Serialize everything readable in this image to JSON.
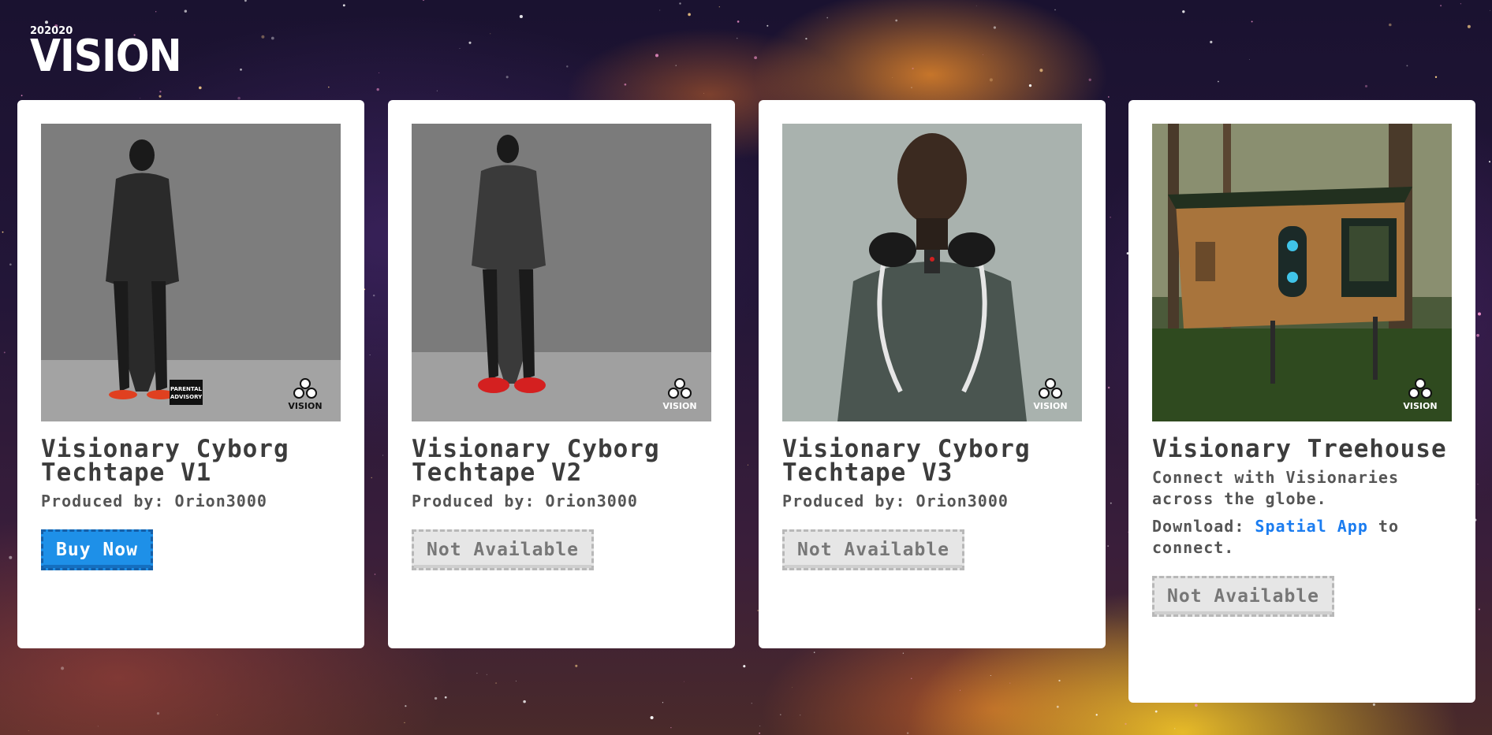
{
  "logo": {
    "top": "202020",
    "main": "VISION"
  },
  "cards": [
    {
      "title": "Visionary Cyborg Techtape V1",
      "producer": "Produced by: Orion3000",
      "button": "Buy Now",
      "available": true,
      "art_watermark": "VISION",
      "advisory": "PARENTAL ADVISORY EXPLICIT CONTENT"
    },
    {
      "title": "Visionary Cyborg Techtape V2",
      "producer": "Produced by: Orion3000",
      "button": "Not Available",
      "available": false,
      "art_watermark": "VISION"
    },
    {
      "title": "Visionary Cyborg Techtape V3",
      "producer": "Produced by: Orion3000",
      "button": "Not Available",
      "available": false,
      "art_watermark": "VISION"
    },
    {
      "title": "Visionary Treehouse",
      "description": "Connect with Visionaries across the globe.",
      "download_label": "Download:",
      "download_link": "Spatial App",
      "download_suffix": "to connect.",
      "button": "Not Available",
      "available": false,
      "art_watermark": "VISION"
    }
  ],
  "colors": {
    "buy_button": "#1e90e8",
    "link": "#1a7cf0",
    "disabled_button": "#e6e6e6"
  }
}
